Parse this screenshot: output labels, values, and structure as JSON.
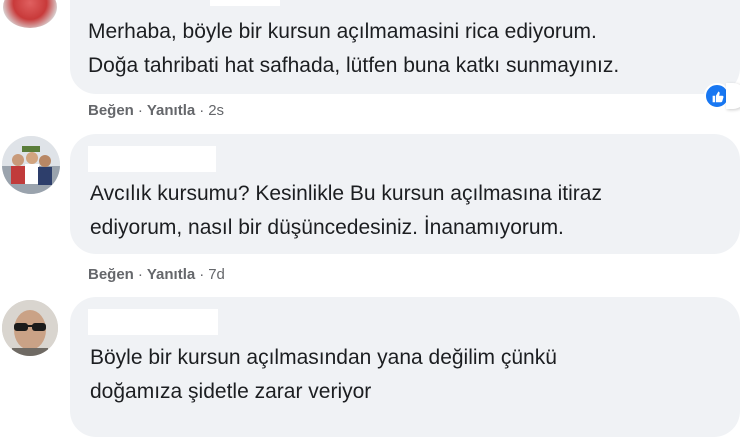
{
  "colors": {
    "bubble_bg": "#f0f2f5",
    "action_text": "#65676b",
    "like_blue": "#1877f2"
  },
  "comments": [
    {
      "lines": [
        "Merhaba, böyle bir kursun açılmamasini rica ediyorum.",
        "Doğa tahribati hat safhada, lütfen buna katkı sunmayınız."
      ],
      "like_label": "Beğen",
      "reply_label": "Yanıtla",
      "separator": "·",
      "time": "2s",
      "reaction_icon": "like-icon"
    },
    {
      "lines": [
        "Avcılık kursumu? Kesinlikle Bu kursun açılmasına itiraz",
        "ediyorum, nasıl bir düşüncedesiniz. İnanamıyorum."
      ],
      "like_label": "Beğen",
      "reply_label": "Yanıtla",
      "separator": "·",
      "time": "7d"
    },
    {
      "lines": [
        "Böyle bir kursun açılmasından yana değilim çünkü",
        "doğamıza şidetle zarar veriyor"
      ]
    }
  ]
}
